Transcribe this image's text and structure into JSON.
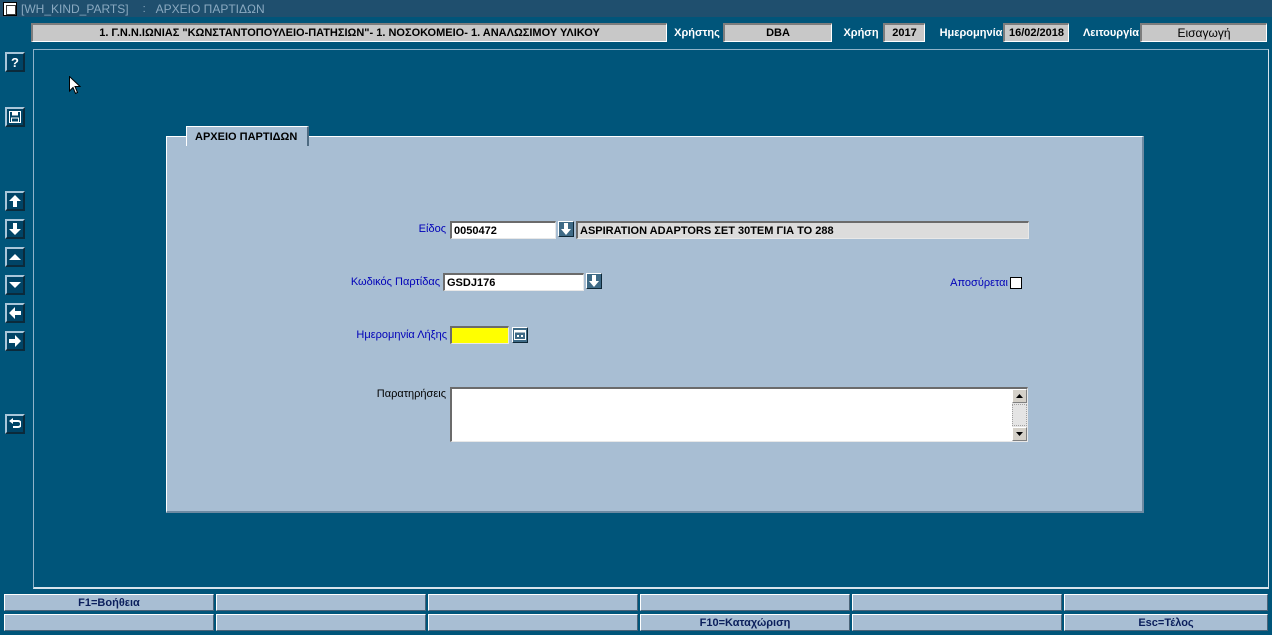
{
  "titlebar": {
    "form_code": "[WH_KIND_PARTS]",
    "separator": ":",
    "form_title": "ΑΡΧΕΙΟ ΠΑΡΤΙΔΩΝ"
  },
  "header": {
    "organization": "1. Γ.Ν.Ν.ΙΩΝΙΑΣ \"ΚΩΝΣΤΑΝΤΟΠΟΥΛΕΙΟ-ΠΑΤΗΣΙΩΝ\"- 1. ΝΟΣΟΚΟΜΕΙΟ- 1. ΑΝΑΛΩΣΙΜΟΥ ΥΛΙΚΟΥ",
    "user_label": "Χρήστης",
    "user_value": "DBA",
    "year_label": "Χρήση",
    "year_value": "2017",
    "date_label": "Ημερομηνία",
    "date_value": "16/02/2018",
    "mode_label": "Λειτουργία",
    "mode_value": "Εισαγωγή"
  },
  "toolbar": {
    "help": "?",
    "icons": [
      "save-icon",
      "first-record-icon",
      "last-record-icon",
      "previous-record-icon",
      "next-record-icon",
      "previous-block-icon",
      "next-block-icon",
      "exit-icon"
    ]
  },
  "form": {
    "tab_title": "ΑΡΧΕΙΟ ΠΑΡΤΙΔΩΝ",
    "item_label": "Είδος",
    "item_code": "0050472",
    "item_description": "ASPIRATION ADAPTORS ΣΕΤ 30ΤΕΜ ΓΙΑ ΤΟ 288",
    "batch_label": "Κωδικός Παρτίδας",
    "batch_code": "GSDJ176",
    "withdrawn_label": "Αποσύρεται",
    "withdrawn": false,
    "expiry_label": "Ημερομηνία Λήξης",
    "expiry_value": "",
    "notes_label": "Παρατηρήσεις",
    "notes_value": ""
  },
  "function_keys": {
    "row1": [
      "F1=Βοήθεια",
      "",
      "",
      "",
      "",
      ""
    ],
    "row2": [
      "",
      "",
      "",
      "F10=Καταχώριση",
      "",
      "Esc=Τέλος"
    ]
  }
}
